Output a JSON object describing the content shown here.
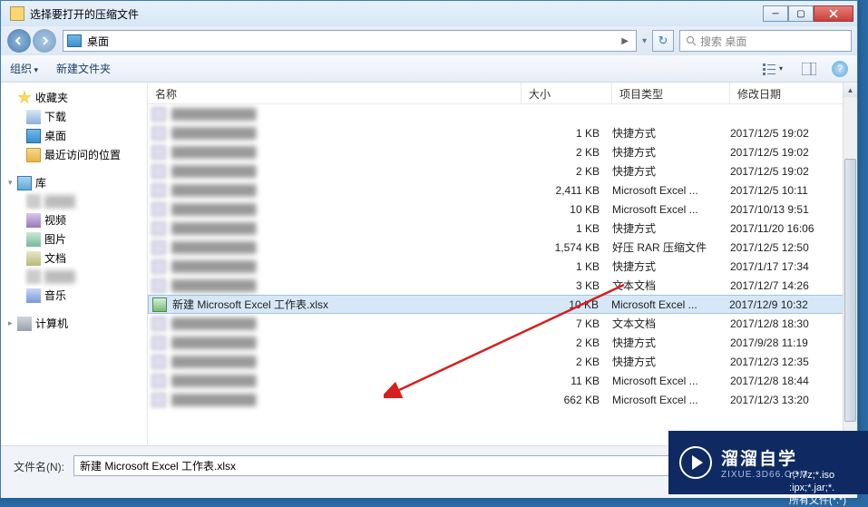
{
  "titlebar": {
    "icon": "archive-icon",
    "title": "选择要打开的压缩文件"
  },
  "addrbar": {
    "location_label": "桌面",
    "search_placeholder": "搜索 桌面"
  },
  "toolbar": {
    "organize": "组织",
    "new_folder": "新建文件夹"
  },
  "sidebar": {
    "favorites": {
      "label": "收藏夹",
      "items": [
        {
          "icon": "downloads-icon",
          "label": "下载"
        },
        {
          "icon": "desktop-icon",
          "label": "桌面"
        },
        {
          "icon": "recent-icon",
          "label": "最近访问的位置"
        }
      ]
    },
    "libraries": {
      "label": "库",
      "items": [
        {
          "icon": "blur-icon",
          "label": ""
        },
        {
          "icon": "video-icon",
          "label": "视频"
        },
        {
          "icon": "picture-icon",
          "label": "图片"
        },
        {
          "icon": "document-icon",
          "label": "文档"
        },
        {
          "icon": "blur-icon",
          "label": ""
        },
        {
          "icon": "music-icon",
          "label": "音乐"
        }
      ]
    },
    "computer": {
      "label": "计算机"
    }
  },
  "headers": {
    "name": "名称",
    "size": "大小",
    "type": "项目类型",
    "date": "修改日期"
  },
  "rows": [
    {
      "name": "",
      "size": "",
      "type": "",
      "date": "",
      "blur": true
    },
    {
      "name": "",
      "size": "1 KB",
      "type": "快捷方式",
      "date": "2017/12/5 19:02",
      "blur": true
    },
    {
      "name": "",
      "size": "2 KB",
      "type": "快捷方式",
      "date": "2017/12/5 19:02",
      "blur": true
    },
    {
      "name": "",
      "size": "2 KB",
      "type": "快捷方式",
      "date": "2017/12/5 19:02",
      "blur": true
    },
    {
      "name": "",
      "size": "2,411 KB",
      "type": "Microsoft Excel ...",
      "date": "2017/12/5 10:11",
      "blur": true
    },
    {
      "name": "",
      "size": "10 KB",
      "type": "Microsoft Excel ...",
      "date": "2017/10/13 9:51",
      "blur": true
    },
    {
      "name": "",
      "size": "1 KB",
      "type": "快捷方式",
      "date": "2017/11/20 16:06",
      "blur": true
    },
    {
      "name": "",
      "size": "1,574 KB",
      "type": "好压 RAR 压缩文件",
      "date": "2017/12/5 12:50",
      "blur": true
    },
    {
      "name": "",
      "size": "1 KB",
      "type": "快捷方式",
      "date": "2017/1/17 17:34",
      "blur": true
    },
    {
      "name": "",
      "size": "3 KB",
      "type": "文本文档",
      "date": "2017/12/7 14:26",
      "blur": true
    },
    {
      "name": "新建 Microsoft Excel 工作表.xlsx",
      "size": "10 KB",
      "type": "Microsoft Excel ...",
      "date": "2017/12/9 10:32",
      "blur": false,
      "selected": true,
      "excel": true
    },
    {
      "name": "",
      "size": "7 KB",
      "type": "文本文档",
      "date": "2017/12/8 18:30",
      "blur": true
    },
    {
      "name": "",
      "size": "2 KB",
      "type": "快捷方式",
      "date": "2017/9/28 11:19",
      "blur": true
    },
    {
      "name": "",
      "size": "2 KB",
      "type": "快捷方式",
      "date": "2017/12/3 12:35",
      "blur": true
    },
    {
      "name": "",
      "size": "11 KB",
      "type": "Microsoft Excel ...",
      "date": "2017/12/8 18:44",
      "blur": true
    },
    {
      "name": "",
      "size": "662 KB",
      "type": "Microsoft Excel ...",
      "date": "2017/12/3 13:20",
      "blur": true
    }
  ],
  "filename": {
    "label": "文件名(N):",
    "value": "新建 Microsoft Excel 工作表.xlsx"
  },
  "watermark": {
    "cn": "溜溜自学",
    "en": "ZIXUE.3D66.COM"
  },
  "filter_hints": {
    "line1": "r;*.7z;*.iso",
    "line2": ":ipx;*.jar;*.",
    "line3": "所有文件(*.*)"
  }
}
